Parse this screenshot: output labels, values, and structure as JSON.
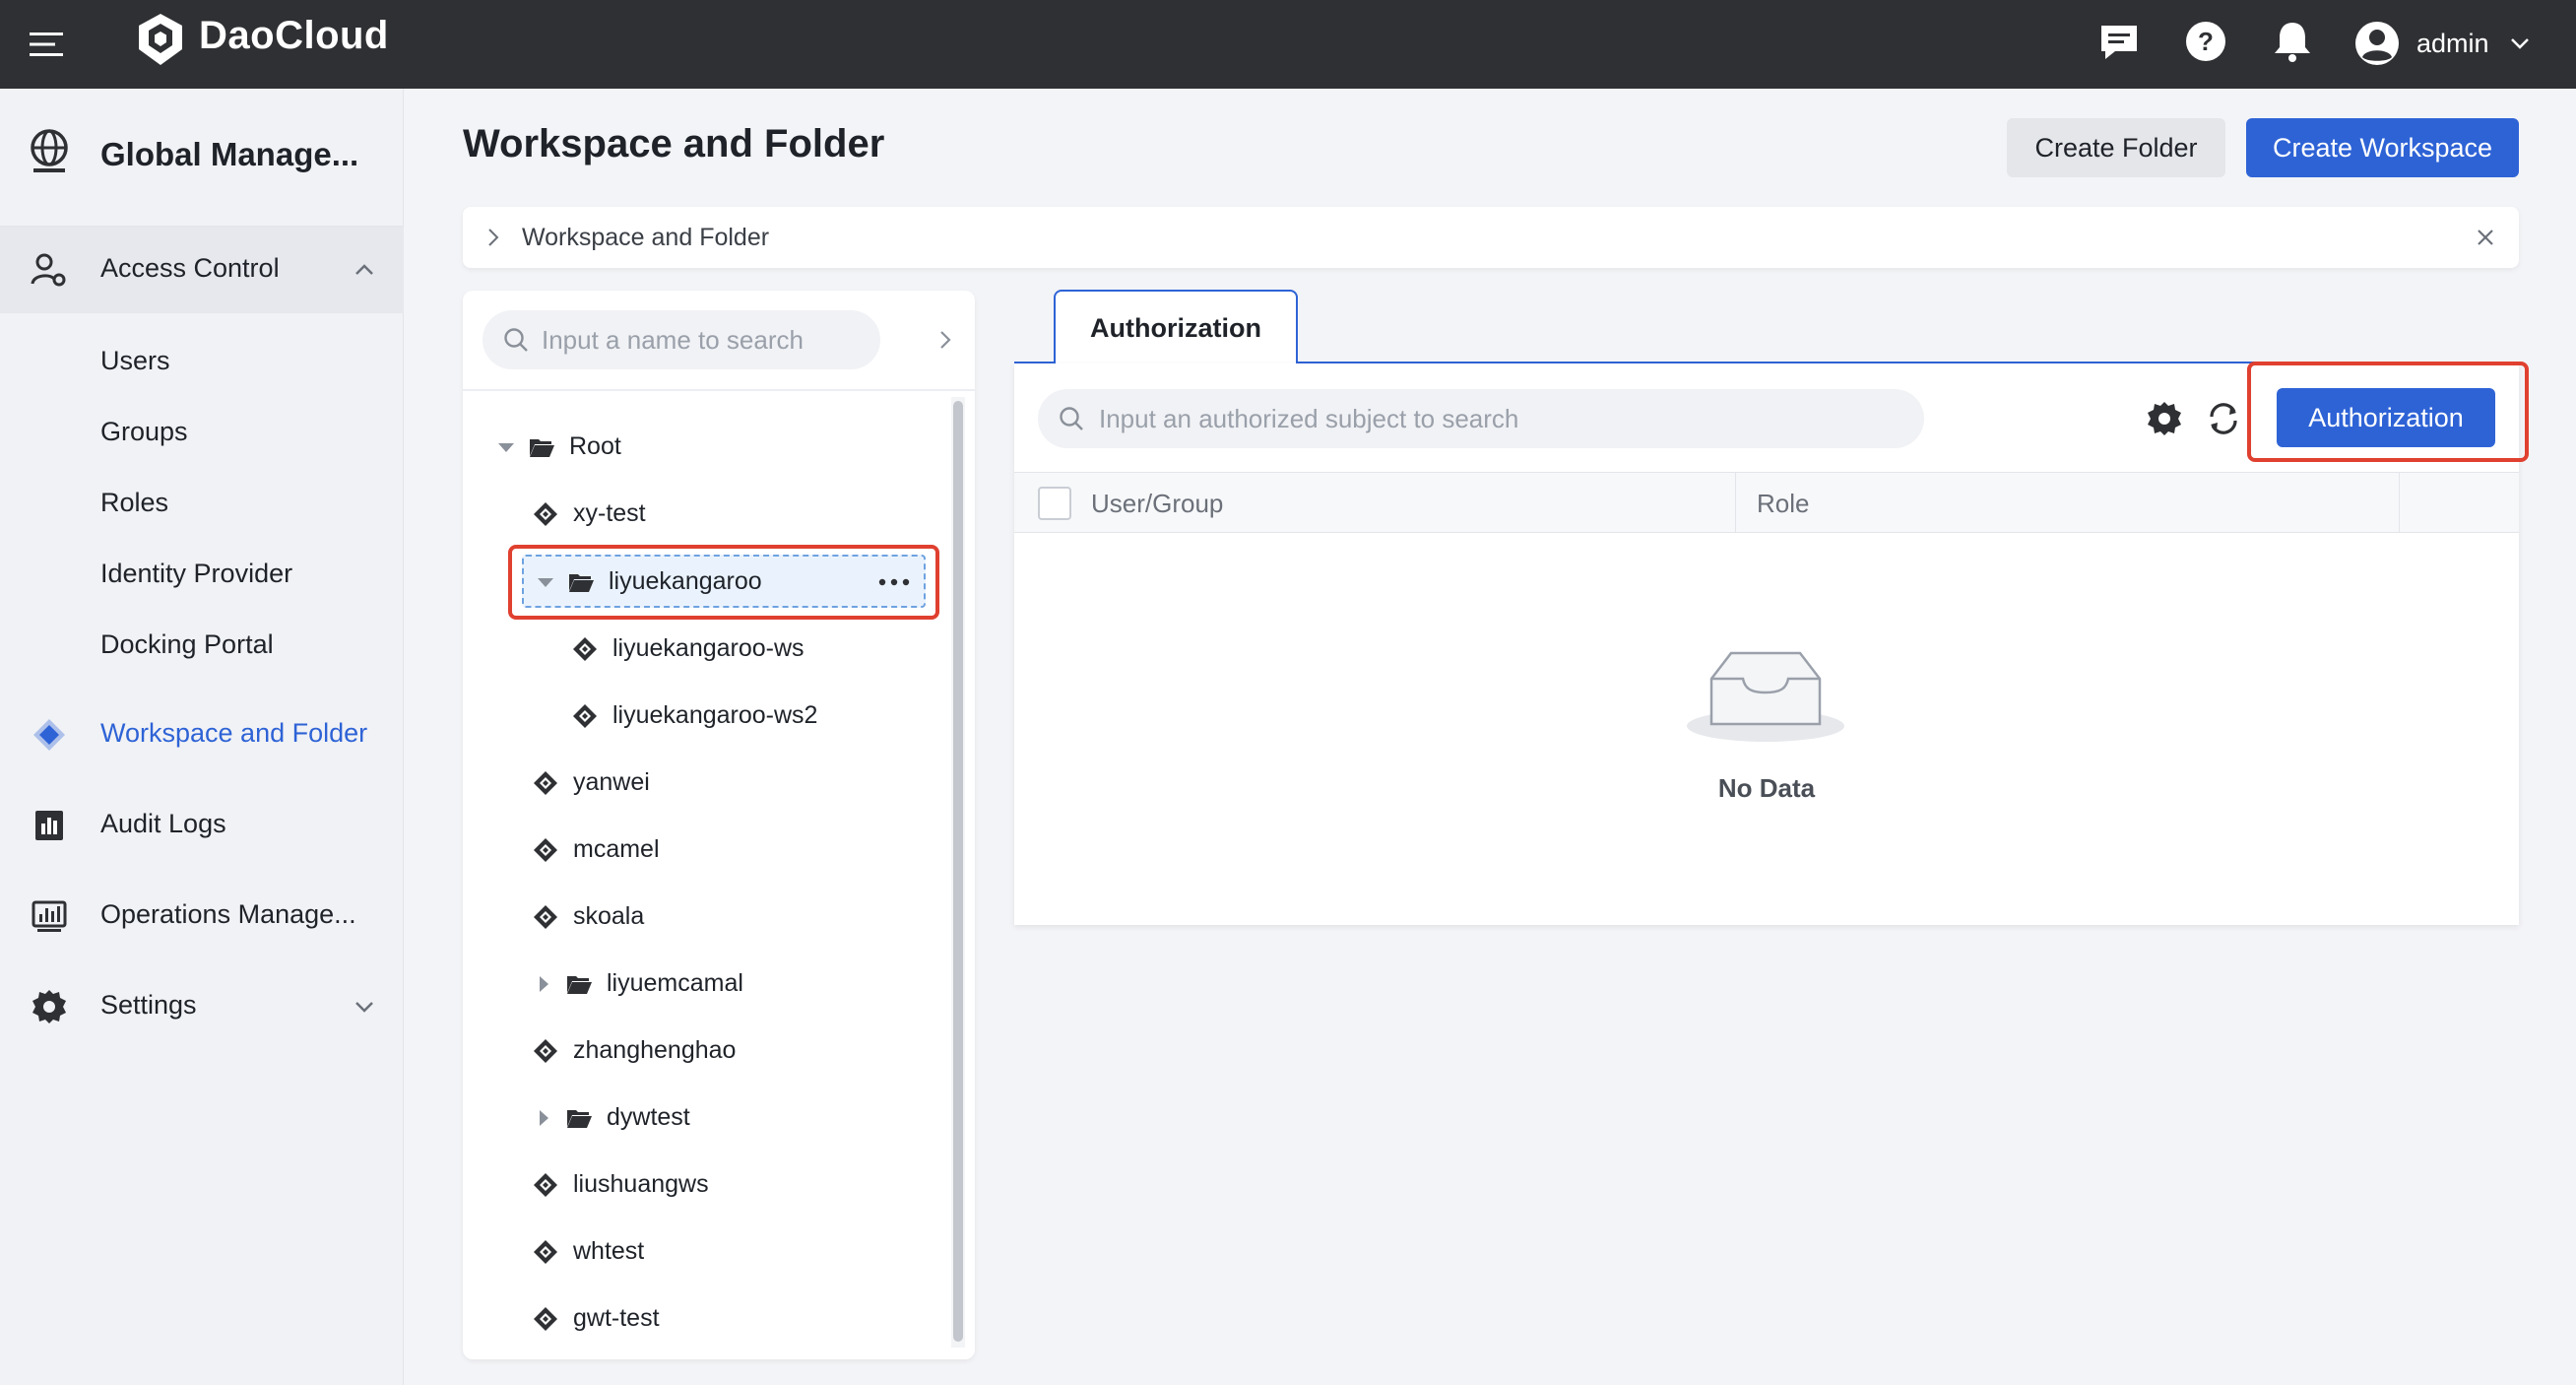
{
  "topbar": {
    "brand": "DaoCloud",
    "user": "admin",
    "icons": [
      "menu-icon",
      "daocloud-logo-icon",
      "message-icon",
      "help-icon",
      "bell-icon",
      "user-avatar-icon",
      "chevron-down-icon"
    ]
  },
  "sidebar": {
    "title": "Global Manage...",
    "items": [
      {
        "label": "Access Control",
        "icon": "user-gear-icon",
        "expanded": true
      },
      {
        "label": "Users"
      },
      {
        "label": "Groups"
      },
      {
        "label": "Roles"
      },
      {
        "label": "Identity Provider"
      },
      {
        "label": "Docking Portal"
      },
      {
        "label": "Workspace and Folder",
        "icon": "workspace-icon",
        "active": true
      },
      {
        "label": "Audit Logs",
        "icon": "audit-icon"
      },
      {
        "label": "Operations Manage...",
        "icon": "operations-icon"
      },
      {
        "label": "Settings",
        "icon": "gear-icon",
        "expanded": false
      }
    ]
  },
  "page": {
    "title": "Workspace and Folder",
    "create_folder": "Create Folder",
    "create_workspace": "Create Workspace",
    "breadcrumb": "Workspace and Folder"
  },
  "tree": {
    "search_placeholder": "Input a name to search",
    "nodes": [
      {
        "label": "Root",
        "type": "folder",
        "expanded": true
      },
      {
        "label": "xy-test",
        "type": "workspace"
      },
      {
        "label": "liyuekangaroo",
        "type": "folder",
        "expanded": true,
        "selected": true
      },
      {
        "label": "liyuekangaroo-ws",
        "type": "workspace"
      },
      {
        "label": "liyuekangaroo-ws2",
        "type": "workspace"
      },
      {
        "label": "yanwei",
        "type": "workspace"
      },
      {
        "label": "mcamel",
        "type": "workspace"
      },
      {
        "label": "skoala",
        "type": "workspace"
      },
      {
        "label": "liyuemcamal",
        "type": "folder",
        "expanded": false
      },
      {
        "label": "zhanghenghao",
        "type": "workspace"
      },
      {
        "label": "dywtest",
        "type": "folder",
        "expanded": false
      },
      {
        "label": "liushuangws",
        "type": "workspace"
      },
      {
        "label": "whtest",
        "type": "workspace"
      },
      {
        "label": "gwt-test",
        "type": "workspace"
      }
    ]
  },
  "auth": {
    "tab": "Authorization",
    "search_placeholder": "Input an authorized subject to search",
    "button": "Authorization",
    "columns": [
      "User/Group",
      "Role"
    ],
    "empty": "No Data"
  },
  "colors": {
    "primary": "#2e63d6",
    "highlight": "#e0402f",
    "topbar": "#2f3033"
  }
}
